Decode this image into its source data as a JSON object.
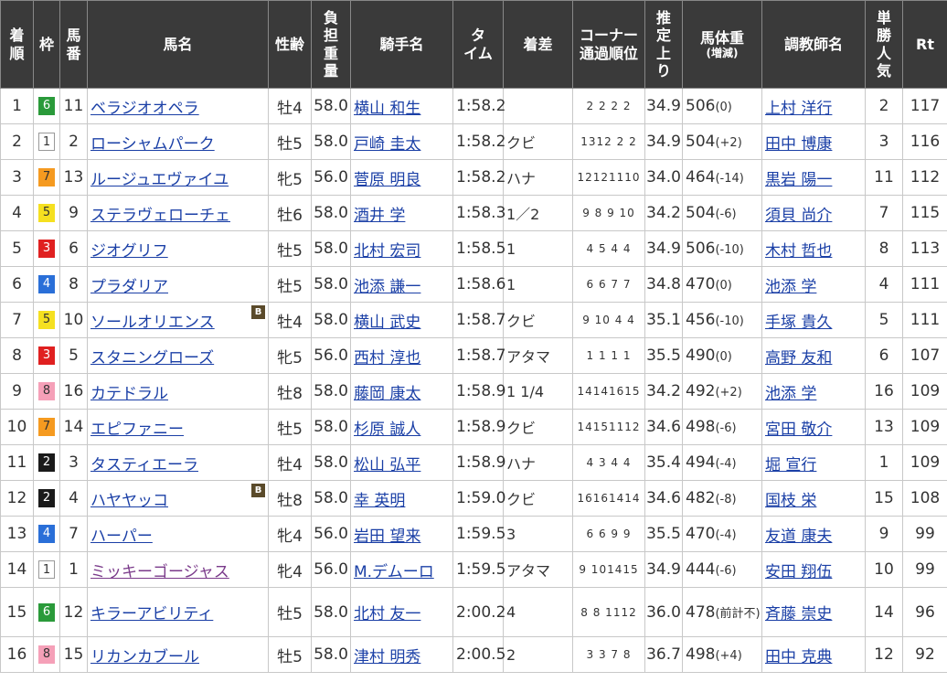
{
  "headers": {
    "rank": "着順",
    "waku": "枠",
    "umaban": "馬番",
    "horse": "馬名",
    "sex_age": "性齢",
    "weight": "負担重量",
    "jockey": "騎手名",
    "time": "タイム",
    "margin": "着差",
    "corner_line1": "コーナー",
    "corner_line2": "通過順位",
    "last3f": "推定上り",
    "body_weight_line1": "馬体重",
    "body_weight_line2": "(増減)",
    "trainer": "調教師名",
    "popularity": "単勝人気",
    "rt": "Rt"
  },
  "rows": [
    {
      "rank": "1",
      "waku": "6",
      "umaban": "11",
      "horse": "ベラジオオペラ",
      "blinker": "",
      "sex_age": "牡4",
      "weight": "58.0",
      "jockey": "横山 和生",
      "time": "1:58.2",
      "margin": "",
      "corner": "2 2 2 2",
      "last3f": "34.9",
      "body_weight": "506",
      "body_diff": "(0)",
      "trainer": "上村 洋行",
      "pop": "2",
      "rt": "117"
    },
    {
      "rank": "2",
      "waku": "1",
      "umaban": "2",
      "horse": "ローシャムパーク",
      "blinker": "",
      "sex_age": "牡5",
      "weight": "58.0",
      "jockey": "戸崎 圭太",
      "time": "1:58.2",
      "margin": "クビ",
      "corner": "1312 2 2",
      "last3f": "34.9",
      "body_weight": "504",
      "body_diff": "(+2)",
      "trainer": "田中 博康",
      "pop": "3",
      "rt": "116"
    },
    {
      "rank": "3",
      "waku": "7",
      "umaban": "13",
      "horse": "ルージュエヴァイユ",
      "blinker": "",
      "sex_age": "牝5",
      "weight": "56.0",
      "jockey": "菅原 明良",
      "time": "1:58.2",
      "margin": "ハナ",
      "corner": "12121110",
      "last3f": "34.0",
      "body_weight": "464",
      "body_diff": "(-14)",
      "trainer": "黒岩 陽一",
      "pop": "11",
      "rt": "112"
    },
    {
      "rank": "4",
      "waku": "5",
      "umaban": "9",
      "horse": "ステラヴェローチェ",
      "blinker": "",
      "sex_age": "牡6",
      "weight": "58.0",
      "jockey": "酒井 学",
      "time": "1:58.3",
      "margin": "1／2",
      "corner": "9 8 9 10",
      "last3f": "34.2",
      "body_weight": "504",
      "body_diff": "(-6)",
      "trainer": "須貝 尚介",
      "pop": "7",
      "rt": "115"
    },
    {
      "rank": "5",
      "waku": "3",
      "umaban": "6",
      "horse": "ジオグリフ",
      "blinker": "",
      "sex_age": "牡5",
      "weight": "58.0",
      "jockey": "北村 宏司",
      "time": "1:58.5",
      "margin": "1",
      "corner": "4 5 4 4",
      "last3f": "34.9",
      "body_weight": "506",
      "body_diff": "(-10)",
      "trainer": "木村 哲也",
      "pop": "8",
      "rt": "113"
    },
    {
      "rank": "6",
      "waku": "4",
      "umaban": "8",
      "horse": "プラダリア",
      "blinker": "",
      "sex_age": "牡5",
      "weight": "58.0",
      "jockey": "池添 謙一",
      "time": "1:58.6",
      "margin": "1",
      "corner": "6 6 7 7",
      "last3f": "34.8",
      "body_weight": "470",
      "body_diff": "(0)",
      "trainer": "池添 学",
      "pop": "4",
      "rt": "111"
    },
    {
      "rank": "7",
      "waku": "5",
      "umaban": "10",
      "horse": "ソールオリエンス",
      "blinker": "B",
      "sex_age": "牡4",
      "weight": "58.0",
      "jockey": "横山 武史",
      "time": "1:58.7",
      "margin": "クビ",
      "corner": "9 10 4 4",
      "last3f": "35.1",
      "body_weight": "456",
      "body_diff": "(-10)",
      "trainer": "手塚 貴久",
      "pop": "5",
      "rt": "111"
    },
    {
      "rank": "8",
      "waku": "3",
      "umaban": "5",
      "horse": "スタニングローズ",
      "blinker": "",
      "sex_age": "牝5",
      "weight": "56.0",
      "jockey": "西村 淳也",
      "time": "1:58.7",
      "margin": "アタマ",
      "corner": "1 1 1 1",
      "last3f": "35.5",
      "body_weight": "490",
      "body_diff": "(0)",
      "trainer": "高野 友和",
      "pop": "6",
      "rt": "107"
    },
    {
      "rank": "9",
      "waku": "8",
      "umaban": "16",
      "horse": "カテドラル",
      "blinker": "",
      "sex_age": "牡8",
      "weight": "58.0",
      "jockey": "藤岡 康太",
      "time": "1:58.9",
      "margin": "1 1/4",
      "corner": "14141615",
      "last3f": "34.2",
      "body_weight": "492",
      "body_diff": "(+2)",
      "trainer": "池添 学",
      "pop": "16",
      "rt": "109"
    },
    {
      "rank": "10",
      "waku": "7",
      "umaban": "14",
      "horse": "エピファニー",
      "blinker": "",
      "sex_age": "牡5",
      "weight": "58.0",
      "jockey": "杉原 誠人",
      "time": "1:58.9",
      "margin": "クビ",
      "corner": "14151112",
      "last3f": "34.6",
      "body_weight": "498",
      "body_diff": "(-6)",
      "trainer": "宮田 敬介",
      "pop": "13",
      "rt": "109"
    },
    {
      "rank": "11",
      "waku": "2",
      "umaban": "3",
      "horse": "タスティエーラ",
      "blinker": "",
      "sex_age": "牡4",
      "weight": "58.0",
      "jockey": "松山 弘平",
      "time": "1:58.9",
      "margin": "ハナ",
      "corner": "4 3 4 4",
      "last3f": "35.4",
      "body_weight": "494",
      "body_diff": "(-4)",
      "trainer": "堀 宣行",
      "pop": "1",
      "rt": "109"
    },
    {
      "rank": "12",
      "waku": "2",
      "umaban": "4",
      "horse": "ハヤヤッコ",
      "blinker": "B",
      "sex_age": "牡8",
      "weight": "58.0",
      "jockey": "幸 英明",
      "time": "1:59.0",
      "margin": "クビ",
      "corner": "16161414",
      "last3f": "34.6",
      "body_weight": "482",
      "body_diff": "(-8)",
      "trainer": "国枝 栄",
      "pop": "15",
      "rt": "108"
    },
    {
      "rank": "13",
      "waku": "4",
      "umaban": "7",
      "horse": "ハーパー",
      "blinker": "",
      "sex_age": "牝4",
      "weight": "56.0",
      "jockey": "岩田 望来",
      "time": "1:59.5",
      "margin": "3",
      "corner": "6 6 9 9",
      "last3f": "35.5",
      "body_weight": "470",
      "body_diff": "(-4)",
      "trainer": "友道 康夫",
      "pop": "9",
      "rt": "99"
    },
    {
      "rank": "14",
      "waku": "1",
      "umaban": "1",
      "horse": "ミッキーゴージャス",
      "blinker": "",
      "sex_age": "牝4",
      "weight": "56.0",
      "jockey": "M.デムーロ",
      "time": "1:59.5",
      "margin": "アタマ",
      "corner": "9 101415",
      "last3f": "34.9",
      "body_weight": "444",
      "body_diff": "(-6)",
      "trainer": "安田 翔伍",
      "pop": "10",
      "rt": "99",
      "visited": true
    },
    {
      "rank": "15",
      "waku": "6",
      "umaban": "12",
      "horse": "キラーアビリティ",
      "blinker": "",
      "sex_age": "牡5",
      "weight": "58.0",
      "jockey": "北村 友一",
      "time": "2:00.2",
      "margin": "4",
      "corner": "8 8 1112",
      "last3f": "36.0",
      "body_weight": "478",
      "body_diff": "(前計不)",
      "trainer": "斉藤 崇史",
      "pop": "14",
      "rt": "96",
      "tall": true
    },
    {
      "rank": "16",
      "waku": "8",
      "umaban": "15",
      "horse": "リカンカブール",
      "blinker": "",
      "sex_age": "牡5",
      "weight": "58.0",
      "jockey": "津村 明秀",
      "time": "2:00.5",
      "margin": "2",
      "corner": "3 3 7 8",
      "last3f": "36.7",
      "body_weight": "498",
      "body_diff": "(+4)",
      "trainer": "田中 克典",
      "pop": "12",
      "rt": "92"
    }
  ]
}
